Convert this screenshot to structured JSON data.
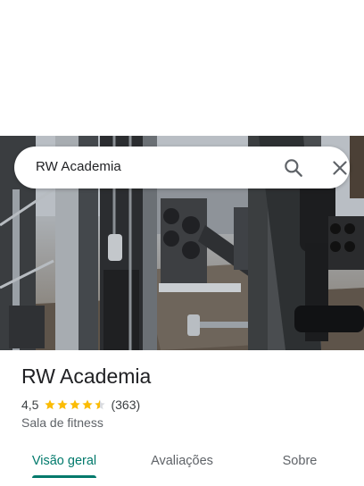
{
  "search": {
    "query": "RW Academia"
  },
  "icons": {
    "search": "search-icon",
    "close": "close-icon",
    "star": "star-icon"
  },
  "place": {
    "name": "RW Academia",
    "rating_text": "4,5",
    "rating": 4.5,
    "rating_max": 5,
    "review_count": "(363)",
    "category": "Sala de fitness"
  },
  "tabs": [
    {
      "label": "Visão geral",
      "active": true
    },
    {
      "label": "Avaliações",
      "active": false
    },
    {
      "label": "Sobre",
      "active": false
    }
  ],
  "colors": {
    "accent": "#00796b",
    "star": "#fbbc04",
    "text_primary": "#202124",
    "text_secondary": "#5f6368"
  }
}
